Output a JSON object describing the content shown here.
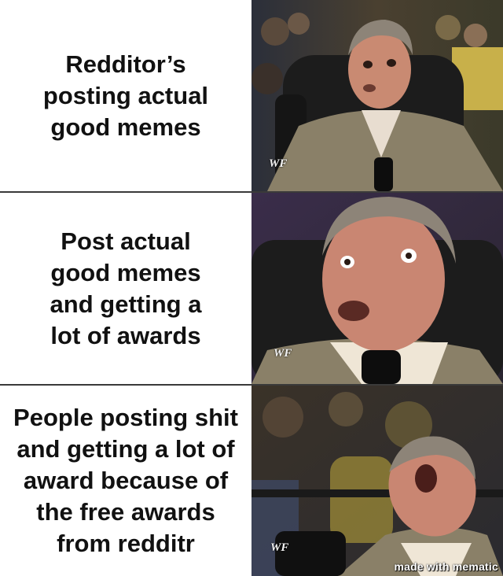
{
  "panels": [
    {
      "caption": "Redditor’s posting actual good memes",
      "reaction": "mildly-surprised-man-in-chair-icon",
      "logo": "WF"
    },
    {
      "caption": "Post actual good memes and getting a lot of awards",
      "reaction": "wide-eyed-excited-man-icon",
      "logo": "WF"
    },
    {
      "caption": "People posting shit and getting a lot of award because of the free awards from redditr",
      "reaction": "head-back-ecstatic-man-icon",
      "logo": "WF"
    }
  ],
  "watermark": "made with mematic",
  "colors": {
    "caption_text": "#111111",
    "background": "#ffffff",
    "divider": "#3a3a3a",
    "suit": "#8a8068",
    "skin": "#c98a72",
    "hair": "#8d8478",
    "chair": "#1c1c1c"
  }
}
